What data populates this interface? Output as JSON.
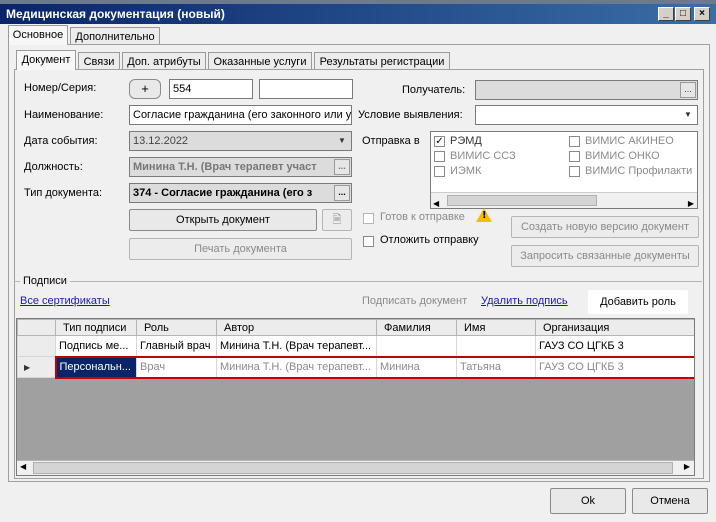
{
  "window": {
    "title": "Медицинская документация (новый)"
  },
  "top_tabs": [
    "Основное",
    "Дополнительно"
  ],
  "inner_tabs": [
    "Документ",
    "Связи",
    "Доп. атрибуты",
    "Оказанные услуги",
    "Результаты регистрации"
  ],
  "form": {
    "number_label": "Номер/Серия:",
    "number_value": "554",
    "number_plus": "+",
    "name_label": "Наименование:",
    "name_value": "Согласие гражданина (его законного или у",
    "date_label": "Дата события:",
    "date_value": "13.12.2022",
    "position_label": "Должность:",
    "position_value": "Минина Т.Н. (Врач терапевт участ",
    "doctype_label": "Тип документа:",
    "doctype_value": "374 - Согласие гражданина (его з",
    "recipient_label": "Получатель:",
    "condition_label": "Условие выявления:",
    "send_label": "Отправка в",
    "ellipsis": "..."
  },
  "send_targets": [
    {
      "label": "РЭМД",
      "checked": true
    },
    {
      "label": "ВИМИС АКИНЕО",
      "checked": false
    },
    {
      "label": "ВИМИС ССЗ",
      "checked": false
    },
    {
      "label": "ВИМИС ОНКО",
      "checked": false
    },
    {
      "label": "ИЭМК",
      "checked": false
    },
    {
      "label": "ВИМИС Профилактика",
      "checked": false
    }
  ],
  "buttons": {
    "open_doc": "Открыть документ",
    "print_doc": "Печать документа",
    "create_version": "Создать новую версию документ",
    "request_linked": "Запросить связанные документы",
    "ok": "Ok",
    "cancel": "Отмена"
  },
  "options": {
    "ready_to_send": "Готов к отправке",
    "postpone_send": "Отложить отправку"
  },
  "signatures": {
    "group_label": "Подписи",
    "all_certs": "Все сертификаты",
    "sign_doc": "Подписать документ",
    "delete_sig": "Удалить подпись",
    "add_role": "Добавить роль",
    "columns": [
      "Тип подписи",
      "Роль",
      "Автор",
      "Фамилия",
      "Имя",
      "Организация"
    ],
    "rows": [
      [
        "Подпись ме...",
        "Главный врач",
        "Минина Т.Н. (Врач терапевт...",
        "",
        "",
        "ГАУЗ СО ЦГКБ 3"
      ],
      [
        "Персональн...",
        "Врач",
        "Минина Т.Н. (Врач терапевт...",
        "Минина",
        "Татьяна",
        "ГАУЗ СО ЦГКБ 3"
      ]
    ]
  }
}
